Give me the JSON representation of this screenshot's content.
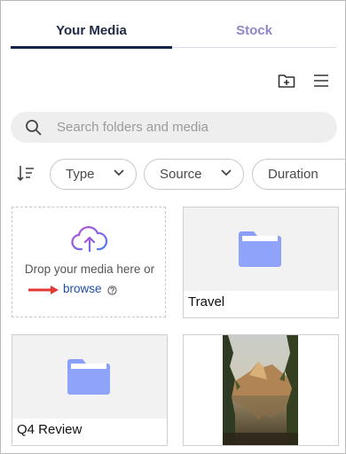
{
  "tabs": [
    {
      "label": "Your Media",
      "active": true
    },
    {
      "label": "Stock",
      "active": false
    }
  ],
  "toolbar": {
    "new_folder_icon": "folder-plus-icon",
    "menu_icon": "hamburger-menu-icon"
  },
  "search": {
    "placeholder": "Search folders and media",
    "value": ""
  },
  "filters": {
    "sort_icon": "sort-descending-icon",
    "chips": [
      "Type",
      "Source",
      "Duration"
    ]
  },
  "upload": {
    "prompt": "Drop your media here or",
    "browse_label": "browse",
    "help_icon": "question-circle-icon",
    "cloud_icon": "cloud-upload-icon",
    "arrow_color": "#e53935"
  },
  "items": [
    {
      "label": "Travel",
      "kind": "folder"
    },
    {
      "label": "Q4 Review",
      "kind": "folder"
    },
    {
      "label": "",
      "kind": "image"
    }
  ],
  "colors": {
    "active_tab": "#14234a",
    "inactive_tab": "#8d86c9",
    "folder": "#8aa0f8",
    "link": "#1f4fa8"
  }
}
